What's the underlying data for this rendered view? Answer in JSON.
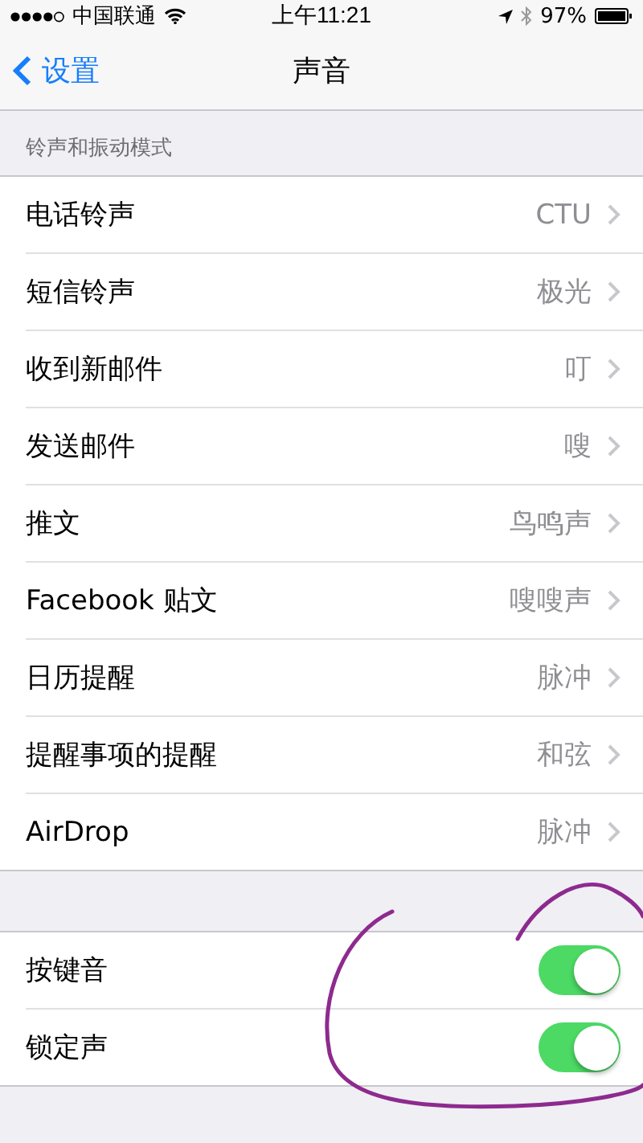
{
  "status_bar": {
    "carrier": "中国联通",
    "time": "上午11:21",
    "battery": "97%"
  },
  "nav": {
    "back": "设置",
    "title": "声音"
  },
  "sections": [
    {
      "header": "铃声和振动模式",
      "rows": [
        {
          "kind": "detail",
          "label": "电话铃声",
          "value": "CTU"
        },
        {
          "kind": "detail",
          "label": "短信铃声",
          "value": "极光"
        },
        {
          "kind": "detail",
          "label": "收到新邮件",
          "value": "叮"
        },
        {
          "kind": "detail",
          "label": "发送邮件",
          "value": "嗖"
        },
        {
          "kind": "detail",
          "label": "推文",
          "value": "鸟鸣声"
        },
        {
          "kind": "detail",
          "label": "Facebook 贴文",
          "value": "嗖嗖声"
        },
        {
          "kind": "detail",
          "label": "日历提醒",
          "value": "脉冲"
        },
        {
          "kind": "detail",
          "label": "提醒事项的提醒",
          "value": "和弦"
        },
        {
          "kind": "detail",
          "label": "AirDrop",
          "value": "脉冲"
        }
      ]
    },
    {
      "rows": [
        {
          "kind": "toggle",
          "label": "按键音",
          "on": true
        },
        {
          "kind": "toggle",
          "label": "锁定声",
          "on": true
        }
      ]
    }
  ]
}
